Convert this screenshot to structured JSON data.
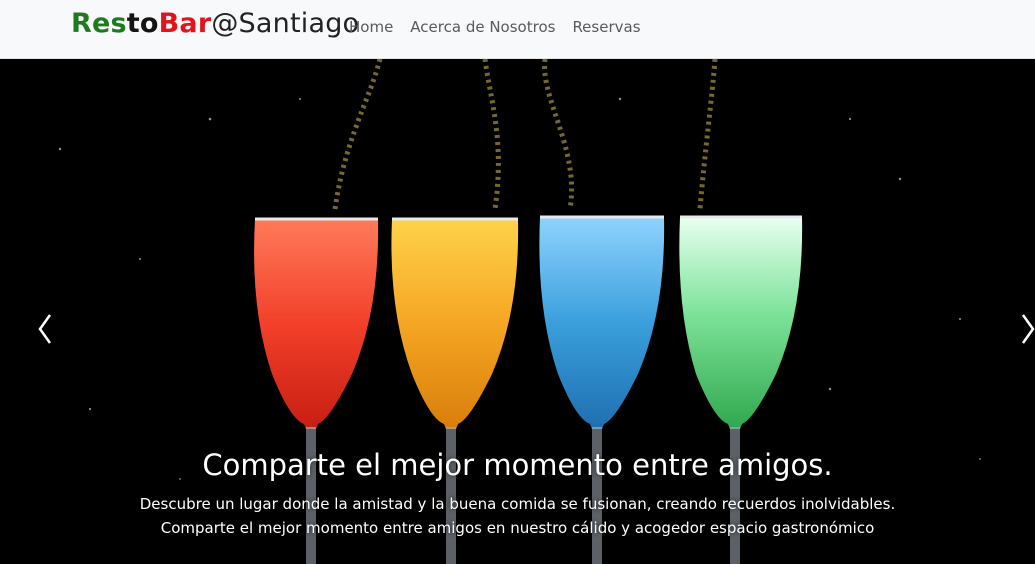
{
  "brand": {
    "part1": "Res",
    "part2": "to",
    "part3": "Bar",
    "part4": "@Santiago"
  },
  "nav": {
    "items": [
      "Home",
      "Acerca de Nosotros",
      "Reservas"
    ]
  },
  "carousel": {
    "title": "Comparte el mejor momento entre amigos.",
    "text": "Descubre un lugar donde la amistad y la buena comida se fusionan, creando recuerdos inolvidables. Comparte el mejor momento entre amigos en nuestro cálido y acogedor espacio gastronómico",
    "prev_icon": "chevron-left-icon",
    "next_icon": "chevron-right-icon"
  },
  "colors": {
    "brand_green": "#1e7a1e",
    "brand_red": "#e3131b",
    "navbar_bg": "#f8f9fa",
    "glass_red": "#f2402a",
    "glass_yellow": "#f5a623",
    "glass_blue": "#3a9fdc",
    "glass_green": "#4fd07a"
  }
}
